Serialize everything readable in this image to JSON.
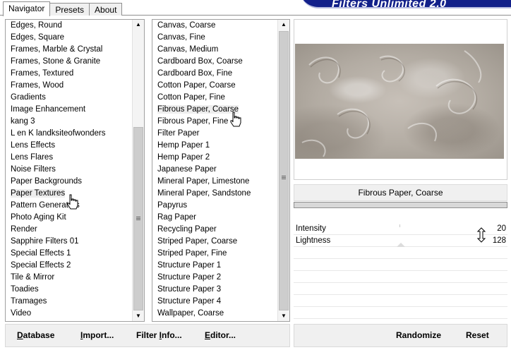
{
  "tabs": [
    {
      "label": "Navigator",
      "active": true
    },
    {
      "label": "Presets",
      "active": false
    },
    {
      "label": "About",
      "active": false
    }
  ],
  "banner": {
    "title": "Filters Unlimited 2.0"
  },
  "categories": [
    "Edges, Round",
    "Edges, Square",
    "Frames, Marble & Crystal",
    "Frames, Stone & Granite",
    "Frames, Textured",
    "Frames, Wood",
    "Gradients",
    "Image Enhancement",
    "kang 3",
    "L en K landksiteofwonders",
    "Lens Effects",
    "Lens Flares",
    "Noise Filters",
    "Paper Backgrounds",
    "Paper Textures",
    "Pattern Generators",
    "Photo Aging Kit",
    "Render",
    "Sapphire Filters 01",
    "Special Effects 1",
    "Special Effects 2",
    "Tile & Mirror",
    "Toadies",
    "Tramages",
    "Video"
  ],
  "selected_category": "Paper Textures",
  "filters": [
    "Canvas, Coarse",
    "Canvas, Fine",
    "Canvas, Medium",
    "Cardboard Box, Coarse",
    "Cardboard Box, Fine",
    "Cotton Paper, Coarse",
    "Cotton Paper, Fine",
    "Fibrous Paper, Coarse",
    "Fibrous Paper, Fine",
    "Filter Paper",
    "Hemp Paper 1",
    "Hemp Paper 2",
    "Japanese Paper",
    "Mineral Paper, Limestone",
    "Mineral Paper, Sandstone",
    "Papyrus",
    "Rag Paper",
    "Recycling Paper",
    "Striped Paper, Coarse",
    "Striped Paper, Fine",
    "Structure Paper 1",
    "Structure Paper 2",
    "Structure Paper 3",
    "Structure Paper 4",
    "Wallpaper, Coarse"
  ],
  "selected_filter": "Fibrous Paper, Coarse",
  "preview": {
    "filter_name": "Fibrous Paper, Coarse"
  },
  "parameters": [
    {
      "label": "Intensity",
      "value": "20"
    },
    {
      "label": "Lightness",
      "value": "128"
    }
  ],
  "buttons": {
    "database_first": "D",
    "database_rest": "atabase",
    "import_first": "I",
    "import_rest": "mport...",
    "filterinfo_pre": "Filter ",
    "filterinfo_u": "I",
    "filterinfo_rest": "nfo...",
    "editor_first": "E",
    "editor_rest": "ditor...",
    "randomize": "Randomize",
    "reset": "Reset"
  },
  "icons": {
    "hand_cursor": "hand-pointer-icon",
    "resize": "vertical-resize-icon",
    "scroll_up": "scroll-up-arrow-icon",
    "scroll_down": "scroll-down-arrow-icon"
  },
  "colors": {
    "banner": "#12208a",
    "texture": "#b3aca3",
    "panel_bg": "#f0f0f0"
  }
}
